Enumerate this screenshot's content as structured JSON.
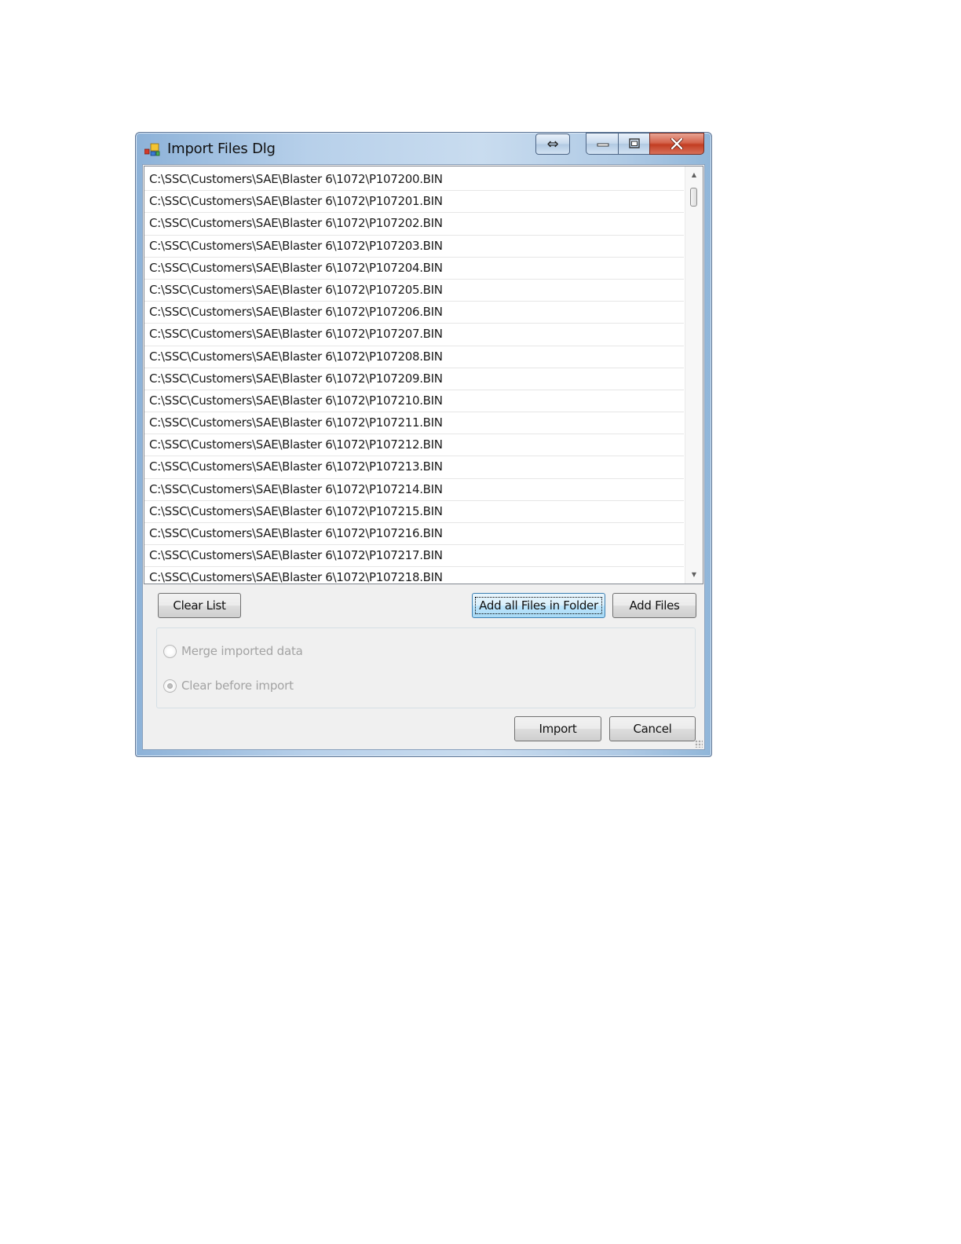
{
  "window": {
    "title": "Import Files Dlg",
    "resize_glyph": "⇔",
    "minimize_glyph": "—",
    "maximize_glyph": "◻",
    "close_glyph": "✕"
  },
  "file_list": {
    "items": [
      "C:\\SSC\\Customers\\SAE\\Blaster 6\\1072\\P107200.BIN",
      "C:\\SSC\\Customers\\SAE\\Blaster 6\\1072\\P107201.BIN",
      "C:\\SSC\\Customers\\SAE\\Blaster 6\\1072\\P107202.BIN",
      "C:\\SSC\\Customers\\SAE\\Blaster 6\\1072\\P107203.BIN",
      "C:\\SSC\\Customers\\SAE\\Blaster 6\\1072\\P107204.BIN",
      "C:\\SSC\\Customers\\SAE\\Blaster 6\\1072\\P107205.BIN",
      "C:\\SSC\\Customers\\SAE\\Blaster 6\\1072\\P107206.BIN",
      "C:\\SSC\\Customers\\SAE\\Blaster 6\\1072\\P107207.BIN",
      "C:\\SSC\\Customers\\SAE\\Blaster 6\\1072\\P107208.BIN",
      "C:\\SSC\\Customers\\SAE\\Blaster 6\\1072\\P107209.BIN",
      "C:\\SSC\\Customers\\SAE\\Blaster 6\\1072\\P107210.BIN",
      "C:\\SSC\\Customers\\SAE\\Blaster 6\\1072\\P107211.BIN",
      "C:\\SSC\\Customers\\SAE\\Blaster 6\\1072\\P107212.BIN",
      "C:\\SSC\\Customers\\SAE\\Blaster 6\\1072\\P107213.BIN",
      "C:\\SSC\\Customers\\SAE\\Blaster 6\\1072\\P107214.BIN",
      "C:\\SSC\\Customers\\SAE\\Blaster 6\\1072\\P107215.BIN",
      "C:\\SSC\\Customers\\SAE\\Blaster 6\\1072\\P107216.BIN",
      "C:\\SSC\\Customers\\SAE\\Blaster 6\\1072\\P107217.BIN",
      "C:\\SSC\\Customers\\SAE\\Blaster 6\\1072\\P107218.BIN"
    ]
  },
  "buttons": {
    "clear_list": "Clear List",
    "add_all_files_in_folder": "Add all Files in Folder",
    "add_files": "Add Files",
    "import": "Import",
    "cancel": "Cancel"
  },
  "options": {
    "merge_imported_data": "Merge imported data",
    "clear_before_import": "Clear before import",
    "selected": "clear_before_import",
    "enabled": false
  },
  "icons": {
    "app": "app-window-icon",
    "resize": "resize-horizontal-icon",
    "scroll_up": "scroll-up-arrow-icon",
    "scroll_down": "scroll-down-arrow-icon"
  }
}
